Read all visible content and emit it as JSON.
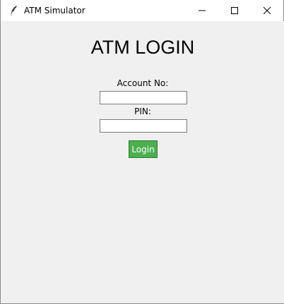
{
  "window": {
    "title": "ATM Simulator",
    "app_icon": "feather-icon",
    "controls": {
      "minimize_icon": "minimize-icon",
      "maximize_icon": "maximize-icon",
      "close_icon": "close-icon"
    }
  },
  "login": {
    "heading": "ATM LOGIN",
    "account_label": "Account No:",
    "account_value": "",
    "pin_label": "PIN:",
    "pin_value": "",
    "button_label": "Login"
  },
  "colors": {
    "background": "#f0f0f0",
    "button": "#4caf50",
    "button_text": "#ffffff"
  }
}
